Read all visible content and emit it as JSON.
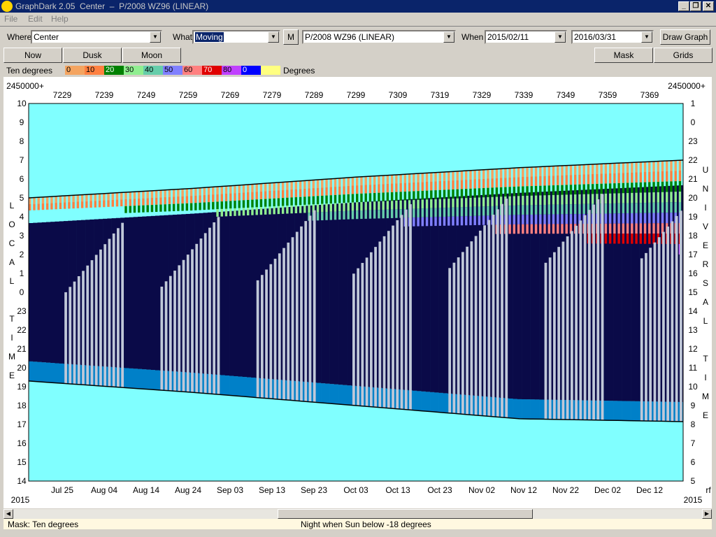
{
  "window": {
    "title": "GraphDark 2.05  Center  –  P/2008 WZ96 (LINEAR)",
    "minimize_icon": "minimize-icon",
    "restore_icon": "restore-icon",
    "close_icon": "close-icon"
  },
  "menu": [
    "File",
    "Edit",
    "Help"
  ],
  "toolbar": {
    "where_label": "Where",
    "where_value": "Center",
    "what_label": "What",
    "what_value": "Moving",
    "m_button": "M",
    "object_value": "P/2008 WZ96 (LINEAR)",
    "when_label": "When",
    "start_date": "2015/02/11",
    "end_date": "2016/03/31",
    "draw_button": "Draw Graph"
  },
  "buttons": {
    "now": "Now",
    "dusk": "Dusk",
    "moon": "Moon",
    "mask": "Mask",
    "grids": "Grids"
  },
  "legend": {
    "label": "Ten degrees",
    "units": "Degrees",
    "bins": [
      {
        "label": "0",
        "color": "#f4a460"
      },
      {
        "label": "10",
        "color": "#ff8040"
      },
      {
        "label": "20",
        "color": "#008000"
      },
      {
        "label": "30",
        "color": "#90ee90"
      },
      {
        "label": "40",
        "color": "#66cdaa"
      },
      {
        "label": "50",
        "color": "#8080ff"
      },
      {
        "label": "60",
        "color": "#ff8080"
      },
      {
        "label": "70",
        "color": "#e00000"
      },
      {
        "label": "80",
        "color": "#c040ff"
      },
      {
        "label": "0",
        "color": "#0000ff"
      },
      {
        "label": "",
        "color": "#ffff80"
      }
    ]
  },
  "chart_data": {
    "type": "heatmap",
    "jd_prefix": "2450000+",
    "jd_ticks": [
      "7229",
      "7239",
      "7249",
      "7259",
      "7269",
      "7279",
      "7289",
      "7299",
      "7309",
      "7319",
      "7329",
      "7339",
      "7349",
      "7359",
      "7369"
    ],
    "date_ticks": [
      "Jul 25",
      "Aug 04",
      "Aug 14",
      "Aug 24",
      "Sep 03",
      "Sep 13",
      "Sep 23",
      "Oct 03",
      "Oct 13",
      "Oct 23",
      "Nov 02",
      "Nov 12",
      "Nov 22",
      "Dec 02",
      "Dec 12"
    ],
    "year_left": "2015",
    "year_right": "2015",
    "bottom_right_mark": "rf",
    "local_time_label": "LOCAL TIME",
    "local_ticks": [
      "10",
      "9",
      "8",
      "7",
      "6",
      "5",
      "4",
      "3",
      "2",
      "1",
      "0",
      "23",
      "22",
      "21",
      "20",
      "19",
      "18",
      "17",
      "16",
      "15",
      "14"
    ],
    "universal_label": "UNIVERSAL TIME",
    "universal_ticks": [
      "1",
      "0",
      "23",
      "22",
      "21",
      "20",
      "19",
      "18",
      "17",
      "16",
      "15",
      "14",
      "13",
      "12",
      "11",
      "10",
      "9",
      "8",
      "7",
      "6",
      "5"
    ],
    "colors": {
      "daylight": "#80ffff",
      "twilight": "#0080c8",
      "night": "#0a0a48",
      "moonlight": "#c0c8d8"
    },
    "series": [
      {
        "name": "dawn",
        "values": [
          5.0,
          5.5,
          6.1,
          6.6,
          7.0
        ]
      },
      {
        "name": "dusk",
        "values": [
          19.3,
          18.7,
          18.0,
          17.3,
          17.15
        ]
      }
    ]
  },
  "scrollbar": {
    "left_icon": "scroll-left-icon",
    "right_icon": "scroll-right-icon"
  },
  "status": {
    "mask_text": "Mask:  Ten degrees",
    "night_text": "Night when Sun below -18 degrees"
  }
}
